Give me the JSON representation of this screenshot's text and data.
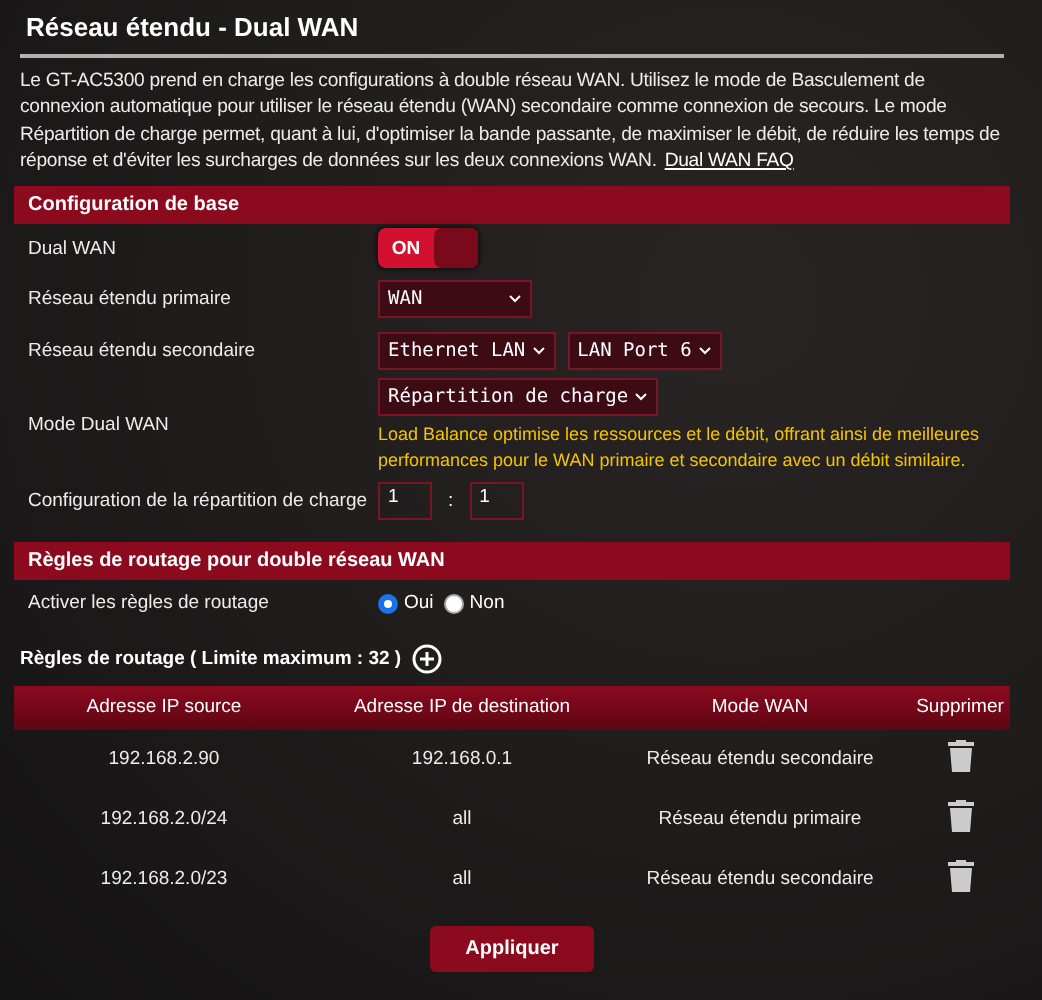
{
  "title": "Réseau étendu - Dual WAN",
  "description": {
    "text": "Le GT-AC5300 prend en charge les configurations à double réseau WAN. Utilisez le mode de Basculement de connexion automatique pour utiliser le réseau étendu (WAN) secondaire comme connexion de secours. Le mode Répartition de charge permet, quant à lui, d'optimiser la bande passante, de maximiser le débit, de réduire les temps de réponse et d'éviter les surcharges de données sur les deux connexions WAN.",
    "link": "Dual WAN FAQ"
  },
  "basic": {
    "header": "Configuration de base",
    "rows": [
      {
        "kind": "toggle",
        "label": "Dual WAN",
        "on": true,
        "on_text": "ON"
      },
      {
        "kind": "selects",
        "label": "Réseau étendu primaire",
        "selects": [
          "WAN"
        ]
      },
      {
        "kind": "selects",
        "label": "Réseau étendu secondaire",
        "selects": [
          "Ethernet LAN",
          "LAN Port 6"
        ]
      },
      {
        "kind": "selects",
        "label": "Mode Dual WAN",
        "selects": [
          "Répartition de charge"
        ],
        "note": "Load Balance optimise les ressources et le débit, offrant ainsi de meilleures performances pour le WAN primaire et secondaire avec un débit similaire."
      },
      {
        "kind": "ratio",
        "label": "Configuration de la répartition de charge",
        "values": [
          "1",
          "1"
        ],
        "separator": ":"
      }
    ]
  },
  "routing": {
    "header": "Règles de routage pour double réseau WAN",
    "enable": {
      "label": "Activer les règles de routage",
      "options": [
        {
          "label": "Oui",
          "selected": true
        },
        {
          "label": "Non",
          "selected": false
        }
      ]
    },
    "rules_title": "Règles de routage ( Limite maximum : 32 )",
    "table": {
      "columns": [
        "Adresse IP source",
        "Adresse IP de destination",
        "Mode WAN",
        "Supprimer"
      ],
      "rows": [
        [
          "192.168.2.90",
          "192.168.0.1",
          "Réseau étendu secondaire"
        ],
        [
          "192.168.2.0/24",
          "all",
          "Réseau étendu primaire"
        ],
        [
          "192.168.2.0/23",
          "all",
          "Réseau étendu secondaire"
        ]
      ]
    }
  },
  "apply": "Appliquer"
}
